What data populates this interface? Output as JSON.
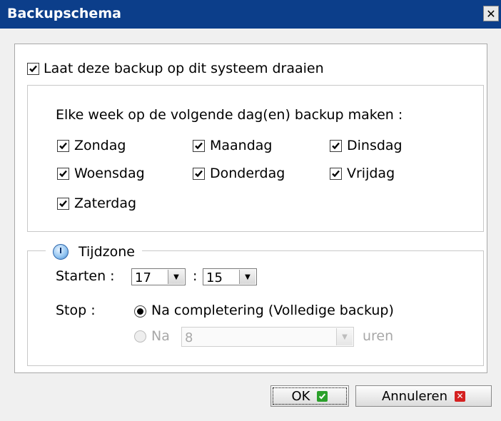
{
  "window": {
    "title": "Backupschema",
    "close_symbol": "✕"
  },
  "run_on_system": {
    "label": "Laat deze backup op dit systeem draaien",
    "checked": true
  },
  "weekly": {
    "heading": "Elke week op de volgende dag(en) backup maken :",
    "days": [
      {
        "label": "Zondag",
        "checked": true
      },
      {
        "label": "Maandag",
        "checked": true
      },
      {
        "label": "Dinsdag",
        "checked": true
      },
      {
        "label": "Woensdag",
        "checked": true
      },
      {
        "label": "Donderdag",
        "checked": true
      },
      {
        "label": "Vrijdag",
        "checked": true
      },
      {
        "label": "Zaterdag",
        "checked": true
      }
    ]
  },
  "timezone": {
    "label": "Tijdzone",
    "start_label": "Starten :",
    "hour": "17",
    "separator": ":",
    "minute": "15",
    "stop_label": "Stop :",
    "stop_option_1": "Na completering (Volledige backup)",
    "stop_option_2_prefix": "Na",
    "stop_option_2_value": "8",
    "stop_option_2_suffix": "uren"
  },
  "buttons": {
    "ok": "OK",
    "cancel": "Annuleren"
  },
  "colors": {
    "titlebar": "#0c3e8a",
    "ok_icon": "#2ba02b",
    "cancel_icon": "#d42020"
  }
}
